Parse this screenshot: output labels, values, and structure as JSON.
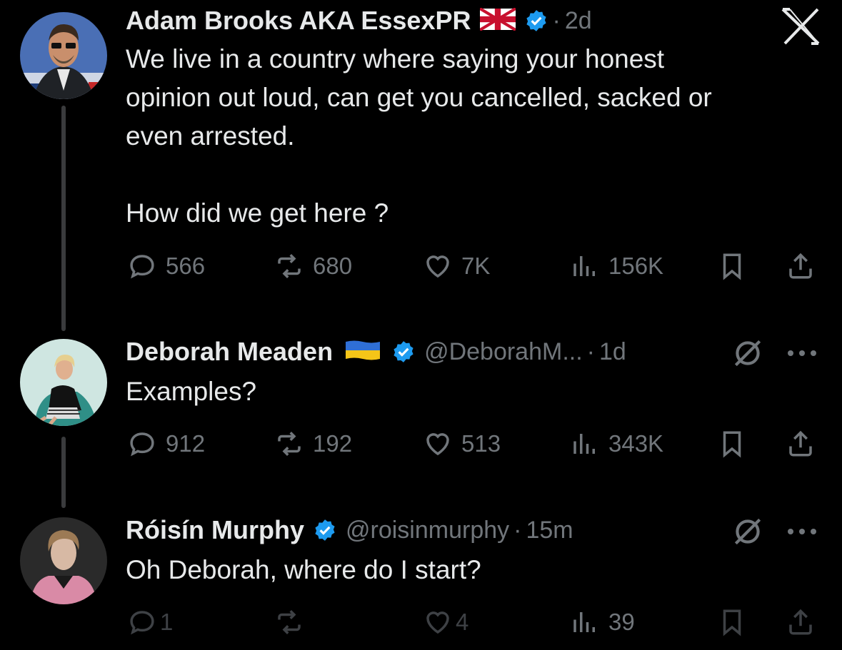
{
  "colors": {
    "background": "#000000",
    "text": "#e7e9ea",
    "muted": "#71767b",
    "verified": "#1d9bf0",
    "thread_line": "#3a3b3d"
  },
  "close_icon": "x-logo-icon",
  "posts": [
    {
      "name": "Adam Brooks AKA EssexPR",
      "handle": "",
      "sep": "·",
      "time": "2d",
      "text": "We live in a country where saying your honest\nopinion out loud, can get you cancelled, sacked or\neven arrested.\n\nHow did we get here ?",
      "stats": {
        "replies": "566",
        "reposts": "680",
        "likes": "7K",
        "views": "156K"
      }
    },
    {
      "name": "Deborah Meaden",
      "handle": "@DeborahM...",
      "sep": "·",
      "time": "1d",
      "text": "Examples?",
      "stats": {
        "replies": "912",
        "reposts": "192",
        "likes": "513",
        "views": "343K"
      }
    },
    {
      "name": "Róisín Murphy",
      "handle": "@roisinmurphy",
      "sep": "·",
      "time": "15m",
      "text": "Oh Deborah, where do I start?",
      "stats": {
        "replies": "1",
        "reposts": "",
        "likes": "4",
        "views": "39"
      }
    }
  ]
}
